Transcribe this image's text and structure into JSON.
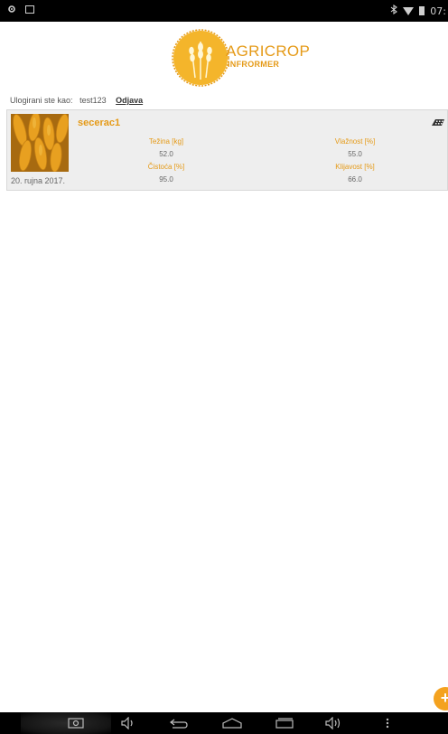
{
  "status_bar": {
    "left_icons": [
      "settings-icon",
      "image-icon"
    ],
    "right_icons": [
      "bluetooth-icon",
      "wifi-icon",
      "battery-icon"
    ],
    "time": "07:"
  },
  "logo": {
    "title": "AGRICROP",
    "subtitle": "INFRORMER"
  },
  "session": {
    "logged_in_label": "Ulogirani ste kao:",
    "username": "test123",
    "logout_link": "Odjava"
  },
  "records": [
    {
      "name": "secerac1",
      "date": "20. rujna 2017.",
      "fields": {
        "tezina_label": "Težina [kg]",
        "tezina_value": "52.0",
        "vlaznost_label": "Vlažnost [%]",
        "vlaznost_value": "55.0",
        "cistoca_label": "Čistoća [%]",
        "cistoca_value": "95.0",
        "klijavost_label": "Klijavost [%]",
        "klijavost_value": "66.0"
      },
      "action_icon": "device-icon"
    }
  ],
  "fab": {
    "label": "+"
  },
  "nav_bar": {
    "items": [
      "screenshot-icon",
      "volume-down-icon",
      "back-icon",
      "home-icon",
      "recents-icon",
      "volume-up-icon",
      "menu-icon"
    ]
  },
  "colors": {
    "accent": "#e59a17",
    "fab": "#f4a21f",
    "card_background": "#eeeeee"
  }
}
